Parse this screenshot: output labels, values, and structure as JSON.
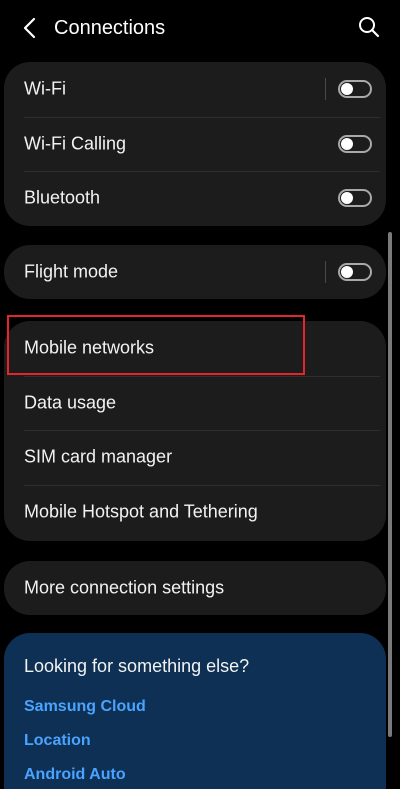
{
  "header": {
    "title": "Connections",
    "back_icon": "chevron-left-icon",
    "search_icon": "search-icon"
  },
  "groups": {
    "g1": [
      {
        "label": "Wi-Fi",
        "toggle": false
      },
      {
        "label": "Wi-Fi Calling",
        "toggle": false
      },
      {
        "label": "Bluetooth",
        "toggle": false
      }
    ],
    "g2": [
      {
        "label": "Flight mode",
        "toggle": false
      }
    ],
    "g3": [
      {
        "label": "Mobile networks"
      },
      {
        "label": "Data usage"
      },
      {
        "label": "SIM card manager"
      },
      {
        "label": "Mobile Hotspot and Tethering"
      }
    ],
    "g4": [
      {
        "label": "More connection settings"
      }
    ]
  },
  "suggestions": {
    "title": "Looking for something else?",
    "links": [
      "Samsung Cloud",
      "Location",
      "Android Auto"
    ]
  },
  "colors": {
    "background": "#000000",
    "card": "#1c1c1c",
    "suggestion_card": "#0d3054",
    "link": "#4aa3ff",
    "highlight": "#e3262c"
  }
}
